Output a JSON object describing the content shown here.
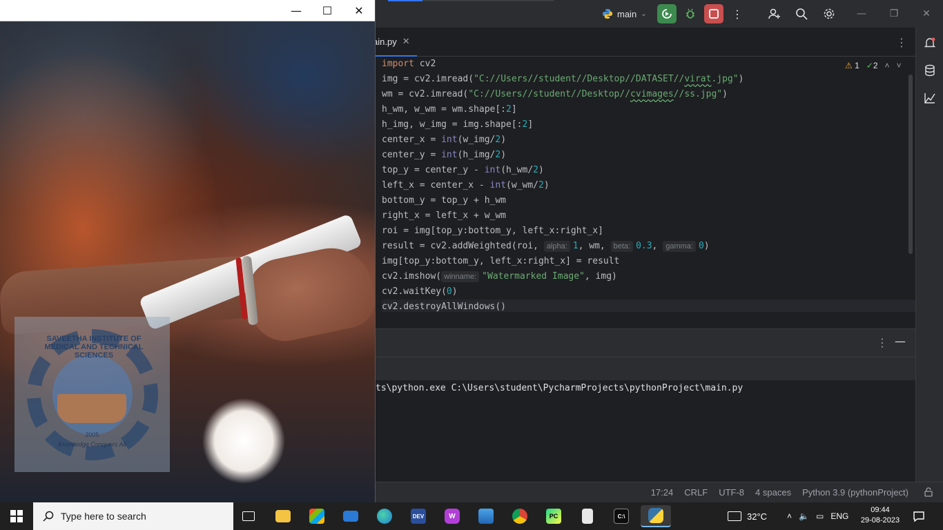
{
  "image_window": {
    "watermark_text": "SAVEETHA INSTITUTE OF MEDICAL AND TECHNICAL SCIENCES",
    "watermark_year": "2005",
    "watermark_motto": "Knowledge Conquers All"
  },
  "titlebar": {
    "branch": "main"
  },
  "editor": {
    "tab_label": "ain.py",
    "inspections": {
      "warnings": "1",
      "weak_warnings": "2"
    },
    "lines": [
      [
        "import",
        " cv2"
      ],
      [
        "img = cv2.imread(",
        "\"C://Users//student//Desktop//DATASET//",
        "virat",
        ".jpg\"",
        ")"
      ],
      [
        "wm = cv2.imread(",
        "\"C://Users//student//Desktop//",
        "cvimages",
        "//ss.jpg\"",
        ")"
      ],
      [
        "h_wm, w_wm = wm.shape[:",
        "2",
        "]"
      ],
      [
        "h_img, w_img = img.shape[:",
        "2",
        "]"
      ],
      [
        "center_x = ",
        "int",
        "(w_img/",
        "2",
        ")"
      ],
      [
        "center_y = ",
        "int",
        "(h_img/",
        "2",
        ")"
      ],
      [
        "top_y = center_y - ",
        "int",
        "(h_wm/",
        "2",
        ")"
      ],
      [
        "left_x = center_x - ",
        "int",
        "(w_wm/",
        "2",
        ")"
      ],
      [
        "bottom_y = top_y + h_wm"
      ],
      [
        "right_x = left_x + w_wm"
      ],
      [
        "roi = img[top_y:bottom_y, left_x:right_x]"
      ],
      [
        "result = cv2.addWeighted(roi, ",
        "alpha:",
        "1",
        ", wm, ",
        "beta:",
        "0.3",
        ", ",
        "gamma:",
        "0",
        ")"
      ],
      [
        "img[top_y:bottom_y, left_x:right_x] = result"
      ],
      [
        "cv2.imshow(",
        "winname:",
        "\"Watermarked Image\"",
        ", img)"
      ],
      [
        "cv2.waitKey(",
        "0",
        ")"
      ],
      [
        "cv2.destroyAllWindows()"
      ]
    ]
  },
  "run_panel": {
    "console_line": "ts\\python.exe C:\\Users\\student\\PycharmProjects\\pythonProject\\main.py"
  },
  "statusbar": {
    "position": "17:24",
    "line_sep": "CRLF",
    "encoding": "UTF-8",
    "indent": "4 spaces",
    "interpreter": "Python 3.9 (pythonProject)"
  },
  "taskbar": {
    "search_placeholder": "Type here to search",
    "temperature": "32°C",
    "language": "ENG",
    "time": "09:44",
    "date": "29-08-2023"
  },
  "colors": {
    "ide_bg": "#1e1f22",
    "panel_bg": "#2b2d30",
    "run_green": "#3d8a4f",
    "stop_red": "#c94f4f",
    "accent_blue": "#3574f0"
  }
}
